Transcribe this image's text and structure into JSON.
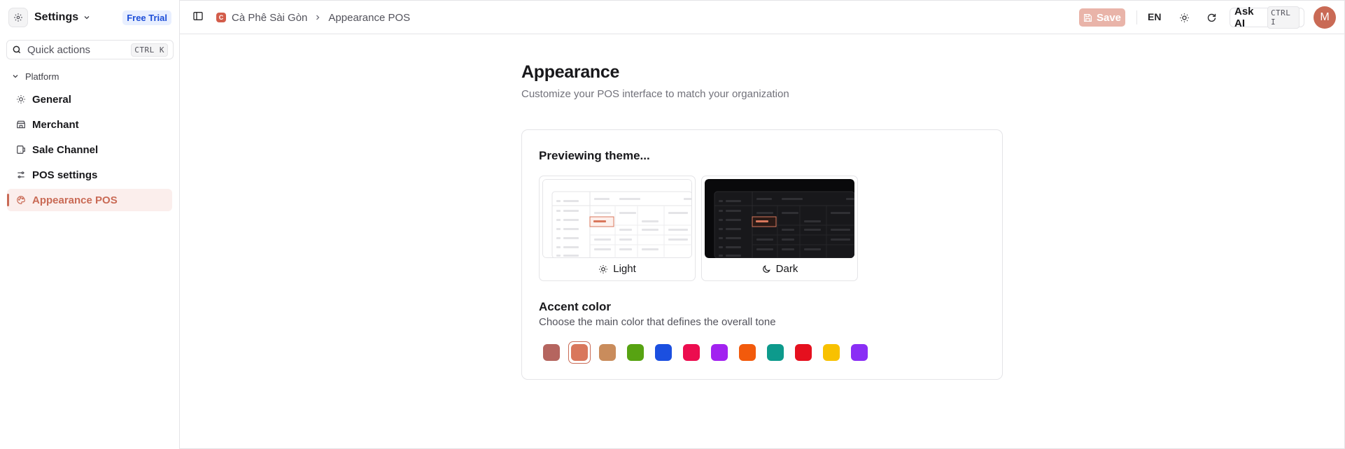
{
  "sidebar": {
    "org_name": "Settings",
    "trial_badge": "Free Trial",
    "quick_actions": {
      "label": "Quick actions",
      "shortcut": "CTRL K"
    },
    "group_label": "Platform",
    "items": [
      {
        "label": "General",
        "icon": "sun-icon"
      },
      {
        "label": "Merchant",
        "icon": "store-icon"
      },
      {
        "label": "Sale Channel",
        "icon": "channel-icon"
      },
      {
        "label": "POS settings",
        "icon": "sliders-icon"
      },
      {
        "label": "Appearance POS",
        "icon": "palette-icon",
        "active": true
      }
    ]
  },
  "topbar": {
    "breadcrumb": {
      "logo_letter": "C",
      "org": "Cà Phê Sài Gòn",
      "page": "Appearance POS"
    },
    "save_label": "Save",
    "language": "EN",
    "ask_ai": {
      "label": "Ask AI",
      "shortcut": "CTRL I"
    },
    "avatar_initial": "M"
  },
  "main": {
    "title": "Appearance",
    "subtitle": "Customize your POS interface to match your organization",
    "card": {
      "heading": "Previewing theme...",
      "themes": [
        {
          "label": "Light",
          "icon": "sun-icon"
        },
        {
          "label": "Dark",
          "icon": "moon-icon"
        }
      ],
      "accent_heading": "Accent color",
      "accent_sub": "Choose the main color that defines the overall tone",
      "accent_colors": [
        "#b5655f",
        "#d9775c",
        "#c98c5c",
        "#57a312",
        "#1b4fe0",
        "#ec0d4f",
        "#a222f0",
        "#f25a0c",
        "#0d9a8c",
        "#e5101e",
        "#f8c100",
        "#8a2ef5"
      ],
      "selected_accent": "#d9775c"
    }
  },
  "colors": {
    "accent": "#c96a55",
    "save_disabled": "#e9b4a9",
    "border": "#e4e4e7"
  }
}
